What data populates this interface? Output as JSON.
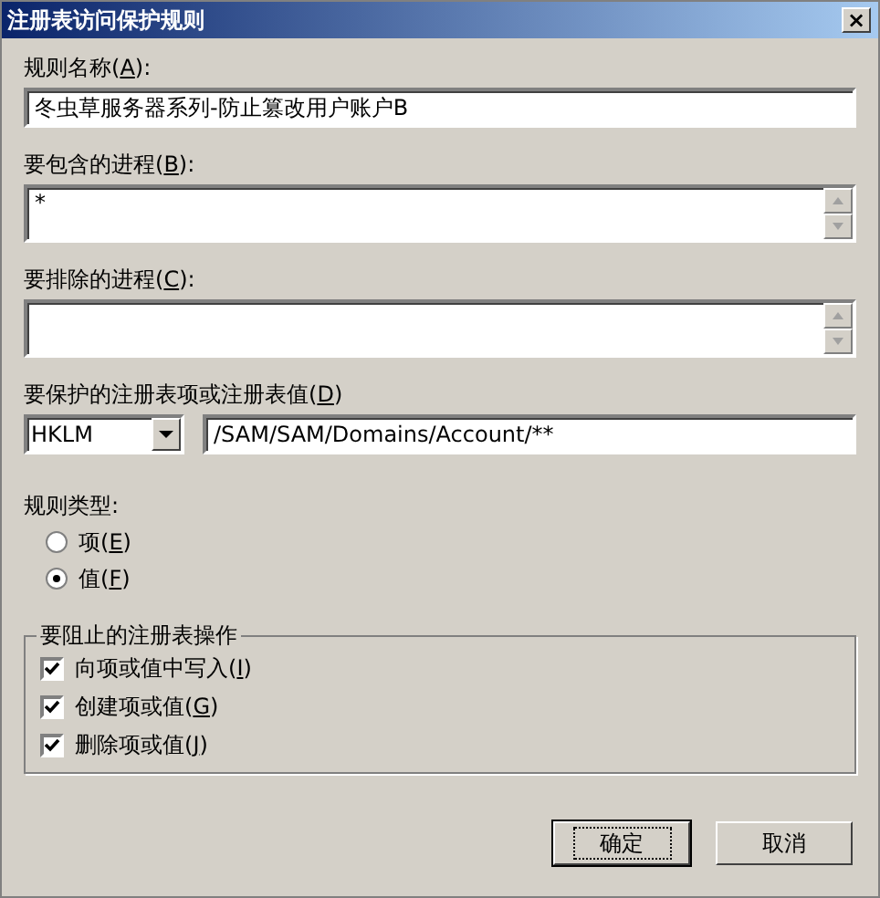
{
  "window": {
    "title": "注册表访问保护规则",
    "close": "×"
  },
  "rule_name": {
    "label": {
      "text": "规则名称(",
      "key": "A",
      "tail": "):"
    },
    "value": "冬虫草服务器系列-防止篡改用户账户B"
  },
  "include_processes": {
    "label": {
      "text": "要包含的进程(",
      "key": "B",
      "tail": "):"
    },
    "value": "*"
  },
  "exclude_processes": {
    "label": {
      "text": "要排除的进程(",
      "key": "C",
      "tail": "):"
    }
  },
  "registry": {
    "label": {
      "text": "要保护的注册表项或注册表值(",
      "key": "D",
      "tail": ")"
    },
    "root": "HKLM",
    "path": "/SAM/SAM/Domains/Account/**"
  },
  "rule_type": {
    "label": "规则类型:",
    "options": [
      {
        "label": {
          "text": "项(",
          "key": "E",
          "tail": ")"
        },
        "selected": false
      },
      {
        "label": {
          "text": "值(",
          "key": "F",
          "tail": ")"
        },
        "selected": true
      }
    ]
  },
  "operations": {
    "title": "要阻止的注册表操作",
    "items": [
      {
        "label": {
          "text": "向项或值中写入(",
          "key": "I",
          "tail": ")"
        },
        "checked": true
      },
      {
        "label": {
          "text": "创建项或值(",
          "key": "G",
          "tail": ")"
        },
        "checked": true
      },
      {
        "label": {
          "text": "删除项或值(",
          "key": "J",
          "tail": ")"
        },
        "checked": true
      }
    ]
  },
  "buttons": [
    {
      "label": "确定",
      "default": true
    },
    {
      "label": "取消",
      "default": false
    }
  ]
}
